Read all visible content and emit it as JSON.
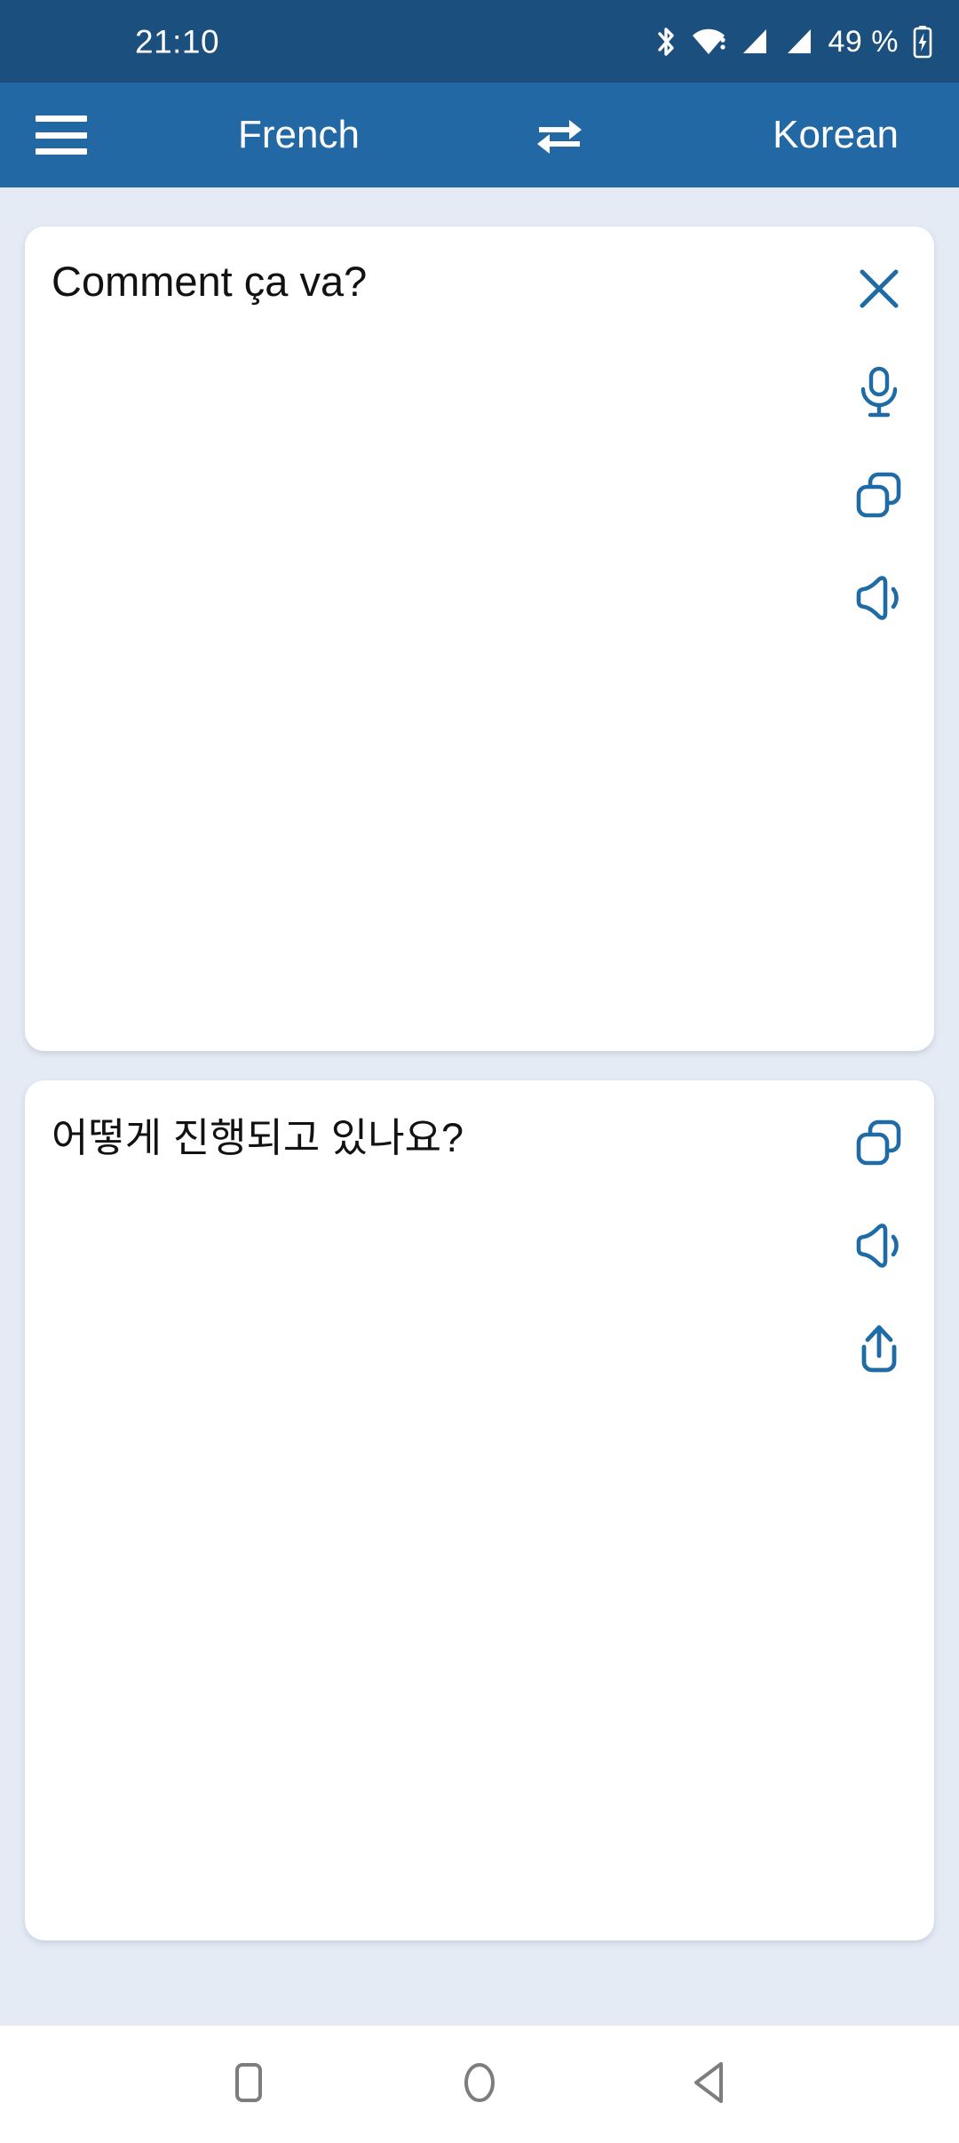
{
  "status_bar": {
    "time": "21:10",
    "battery_percent": "49 %",
    "icons": [
      "bluetooth-icon",
      "wifi-icon",
      "signal-sim1-icon",
      "signal-sim2-icon",
      "battery-charging-icon"
    ],
    "background_color": "#1b4f7e",
    "foreground_color": "#ffffff"
  },
  "app_bar": {
    "menu_icon": "hamburger-menu-icon",
    "source_language": "French",
    "swap_icon": "swap-languages-icon",
    "target_language": "Korean",
    "background_color": "#2268a5",
    "text_color": "#ffffff"
  },
  "source_card": {
    "text": "Comment ça va?",
    "actions": [
      {
        "name": "clear-text-button",
        "icon": "close-icon"
      },
      {
        "name": "voice-input-button",
        "icon": "microphone-icon"
      },
      {
        "name": "copy-source-button",
        "icon": "copy-icon"
      },
      {
        "name": "speak-source-button",
        "icon": "speaker-icon"
      }
    ]
  },
  "target_card": {
    "text": "어떻게 진행되고 있나요?",
    "actions": [
      {
        "name": "copy-translation-button",
        "icon": "copy-icon"
      },
      {
        "name": "speak-translation-button",
        "icon": "speaker-icon"
      },
      {
        "name": "share-translation-button",
        "icon": "share-icon"
      }
    ]
  },
  "nav_bar": {
    "buttons": [
      {
        "name": "recents-button",
        "icon": "square-icon"
      },
      {
        "name": "home-button",
        "icon": "circle-icon"
      },
      {
        "name": "back-button",
        "icon": "triangle-left-icon"
      }
    ],
    "background_color": "#ffffff",
    "icon_color": "#7d7d7d"
  },
  "theme": {
    "page_background": "#e4ebf5",
    "card_background": "#ffffff",
    "accent_blue": "#1f6ba5",
    "text_color": "#121212"
  }
}
